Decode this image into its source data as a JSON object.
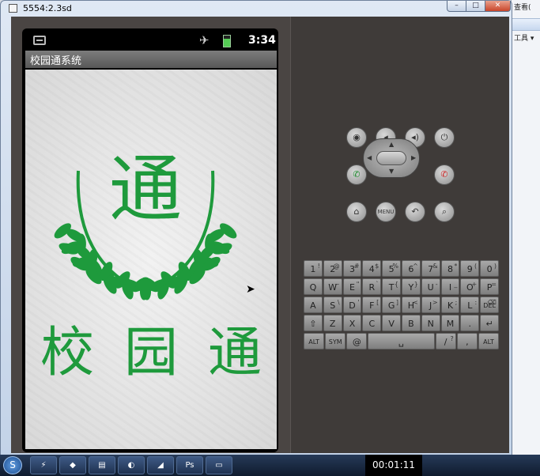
{
  "window": {
    "title": "5554:2.3sd",
    "min": "–",
    "max": "□",
    "close": "✕"
  },
  "bg_app": {
    "menu1": "查看(",
    "menu2": "工具 ▾"
  },
  "phone": {
    "clock": "3:34",
    "app_title": "校园通系统",
    "logo_char": "通",
    "big_chars": [
      "校",
      "园",
      "通"
    ]
  },
  "controls": {
    "row1": [
      "camera-icon",
      "volume-down-icon",
      "volume-up-icon",
      "power-icon"
    ],
    "call": "call-icon",
    "end_call": "end-call-icon",
    "row3": [
      "home-icon",
      "MENU",
      "back-icon",
      "search-icon"
    ]
  },
  "keyboard": {
    "rows": [
      [
        [
          "1",
          "!"
        ],
        [
          "2",
          "@"
        ],
        [
          "3",
          "#"
        ],
        [
          "4",
          "$"
        ],
        [
          "5",
          "%"
        ],
        [
          "6",
          "^"
        ],
        [
          "7",
          "&"
        ],
        [
          "8",
          "*"
        ],
        [
          "9",
          "("
        ],
        [
          "0",
          ")"
        ]
      ],
      [
        [
          "Q",
          ""
        ],
        [
          "W",
          "~"
        ],
        [
          "E",
          "\""
        ],
        [
          "R",
          "`"
        ],
        [
          "T",
          "{"
        ],
        [
          "Y",
          "}"
        ],
        [
          "U",
          "-"
        ],
        [
          "I",
          "_"
        ],
        [
          "O",
          "+"
        ],
        [
          "P",
          "="
        ]
      ],
      [
        [
          "A",
          ""
        ],
        [
          "S",
          "\\"
        ],
        [
          "D",
          "'"
        ],
        [
          "F",
          "["
        ],
        [
          "G",
          "]"
        ],
        [
          "H",
          "<"
        ],
        [
          "J",
          ">"
        ],
        [
          "K",
          ";"
        ],
        [
          "L",
          ":"
        ],
        [
          "DEL",
          "⌫"
        ]
      ],
      [
        [
          "⇧",
          ""
        ],
        [
          "Z",
          ""
        ],
        [
          "X",
          ""
        ],
        [
          "C",
          ""
        ],
        [
          "V",
          ""
        ],
        [
          "B",
          ""
        ],
        [
          "N",
          ""
        ],
        [
          "M",
          ""
        ],
        [
          ".",
          ""
        ],
        [
          "↵",
          ""
        ]
      ],
      [
        [
          "ALT",
          ""
        ],
        [
          "SYM",
          ""
        ],
        [
          "@",
          ""
        ],
        [
          "␣",
          ""
        ],
        [
          "/",
          "?"
        ],
        [
          ",",
          ""
        ],
        [
          "ALT",
          ""
        ]
      ]
    ]
  },
  "taskbar": {
    "start": "S",
    "items": [
      "⚡",
      "◆",
      "▤",
      "◐",
      "◢",
      "Ps",
      "▭"
    ],
    "timer": "00:01:11"
  }
}
